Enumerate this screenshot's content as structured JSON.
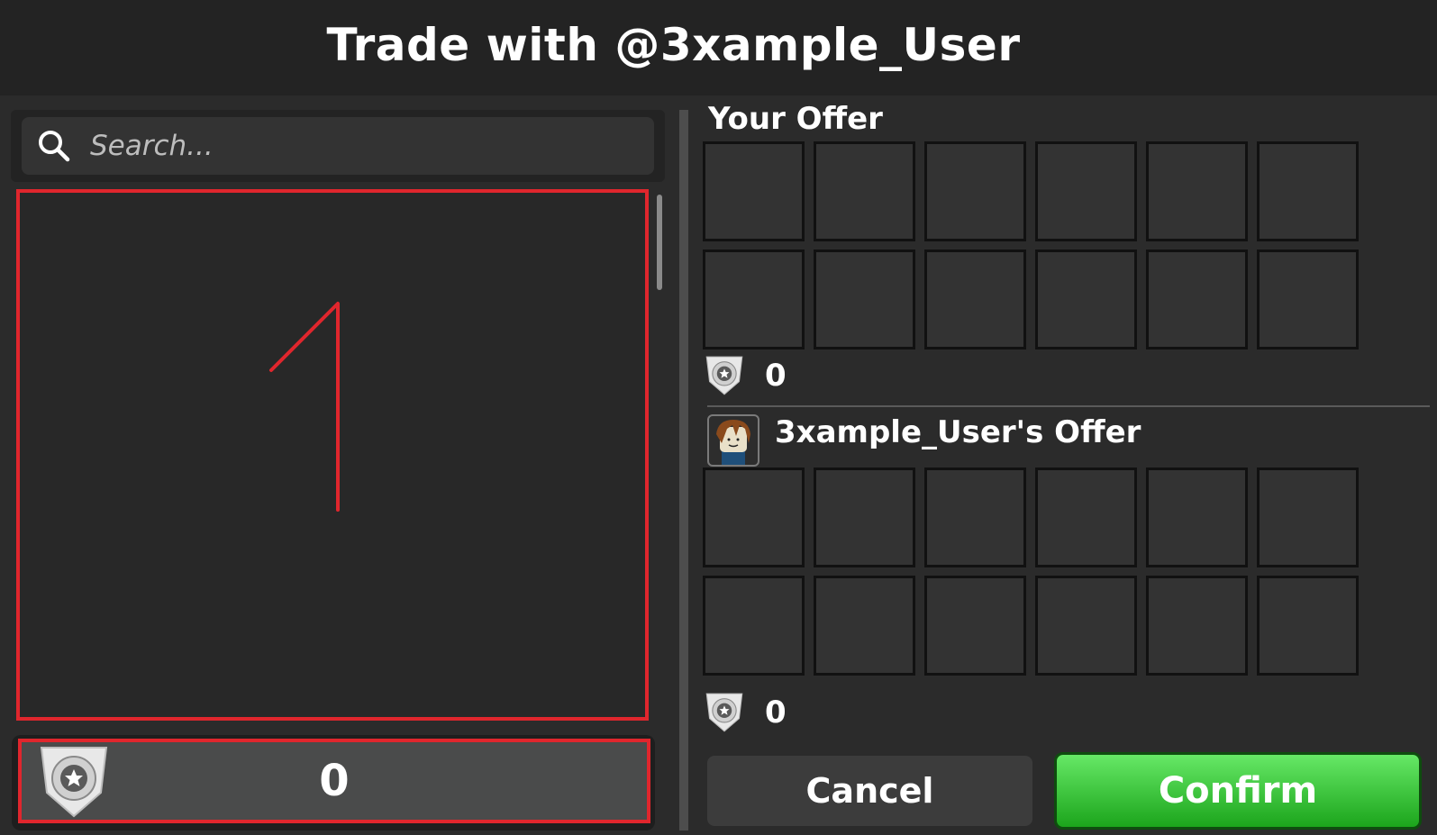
{
  "header": {
    "title": "Trade with @3xample_User"
  },
  "search": {
    "placeholder": "Search..."
  },
  "inventory": {
    "annotation_number": "1",
    "annotation_color": "#e0262d"
  },
  "currency_bar": {
    "amount": "0"
  },
  "your_offer": {
    "title": "Your Offer",
    "slots": 12,
    "currency_amount": "0"
  },
  "their_offer": {
    "title": "3xample_User's Offer",
    "slots": 12,
    "currency_amount": "0"
  },
  "buttons": {
    "cancel": "Cancel",
    "confirm": "Confirm"
  },
  "icons": {
    "search": "search-icon",
    "currency": "badge-icon",
    "avatar": "avatar-icon"
  },
  "colors": {
    "header_bg": "#232323",
    "panel_bg": "#2b2b2b",
    "highlight": "#e0262d",
    "confirm": "#2fc42f"
  }
}
